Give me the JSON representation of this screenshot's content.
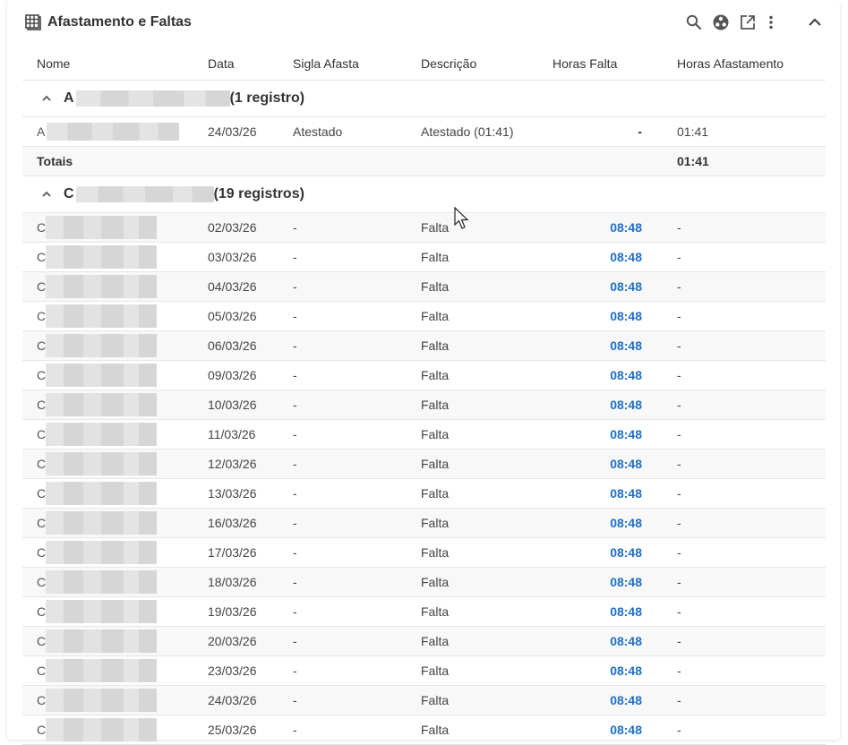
{
  "header": {
    "title": "Afastamento e Faltas",
    "icons": [
      "grid-table-icon",
      "search-icon",
      "share-icon",
      "open-external-icon",
      "more-vert-icon",
      "chevron-up-icon"
    ]
  },
  "columns": {
    "nome": "Nome",
    "data": "Data",
    "sigla": "Sigla Afasta",
    "descricao": "Descrição",
    "horas_falta": "Horas Falta",
    "horas_afastamento": "Horas Afastamento"
  },
  "group1": {
    "initial": "A",
    "count": "(1 registro)",
    "row": {
      "nome_initial": "A",
      "data": "24/03/26",
      "sigla": "Atestado",
      "descricao": "Atestado (01:41)",
      "horas_falta": "-",
      "horas_afastamento": "01:41"
    },
    "totals_label": "Totais",
    "totals_afastamento": "01:41"
  },
  "group2": {
    "initial": "C",
    "count": "(19 registros)",
    "rows": [
      {
        "nome_initial": "C",
        "data": "02/03/26",
        "sigla": "-",
        "descricao": "Falta",
        "horas_falta": "08:48",
        "horas_afastamento": "-"
      },
      {
        "nome_initial": "C",
        "data": "03/03/26",
        "sigla": "-",
        "descricao": "Falta",
        "horas_falta": "08:48",
        "horas_afastamento": "-"
      },
      {
        "nome_initial": "C",
        "data": "04/03/26",
        "sigla": "-",
        "descricao": "Falta",
        "horas_falta": "08:48",
        "horas_afastamento": "-"
      },
      {
        "nome_initial": "C",
        "data": "05/03/26",
        "sigla": "-",
        "descricao": "Falta",
        "horas_falta": "08:48",
        "horas_afastamento": "-"
      },
      {
        "nome_initial": "C",
        "data": "06/03/26",
        "sigla": "-",
        "descricao": "Falta",
        "horas_falta": "08:48",
        "horas_afastamento": "-"
      },
      {
        "nome_initial": "C",
        "data": "09/03/26",
        "sigla": "-",
        "descricao": "Falta",
        "horas_falta": "08:48",
        "horas_afastamento": "-"
      },
      {
        "nome_initial": "C",
        "data": "10/03/26",
        "sigla": "-",
        "descricao": "Falta",
        "horas_falta": "08:48",
        "horas_afastamento": "-"
      },
      {
        "nome_initial": "C",
        "data": "11/03/26",
        "sigla": "-",
        "descricao": "Falta",
        "horas_falta": "08:48",
        "horas_afastamento": "-"
      },
      {
        "nome_initial": "C",
        "data": "12/03/26",
        "sigla": "-",
        "descricao": "Falta",
        "horas_falta": "08:48",
        "horas_afastamento": "-"
      },
      {
        "nome_initial": "C",
        "data": "13/03/26",
        "sigla": "-",
        "descricao": "Falta",
        "horas_falta": "08:48",
        "horas_afastamento": "-"
      },
      {
        "nome_initial": "C",
        "data": "16/03/26",
        "sigla": "-",
        "descricao": "Falta",
        "horas_falta": "08:48",
        "horas_afastamento": "-"
      },
      {
        "nome_initial": "C",
        "data": "17/03/26",
        "sigla": "-",
        "descricao": "Falta",
        "horas_falta": "08:48",
        "horas_afastamento": "-"
      },
      {
        "nome_initial": "C",
        "data": "18/03/26",
        "sigla": "-",
        "descricao": "Falta",
        "horas_falta": "08:48",
        "horas_afastamento": "-"
      },
      {
        "nome_initial": "C",
        "data": "19/03/26",
        "sigla": "-",
        "descricao": "Falta",
        "horas_falta": "08:48",
        "horas_afastamento": "-"
      },
      {
        "nome_initial": "C",
        "data": "20/03/26",
        "sigla": "-",
        "descricao": "Falta",
        "horas_falta": "08:48",
        "horas_afastamento": "-"
      },
      {
        "nome_initial": "C",
        "data": "23/03/26",
        "sigla": "-",
        "descricao": "Falta",
        "horas_falta": "08:48",
        "horas_afastamento": "-"
      },
      {
        "nome_initial": "C",
        "data": "24/03/26",
        "sigla": "-",
        "descricao": "Falta",
        "horas_falta": "08:48",
        "horas_afastamento": "-"
      },
      {
        "nome_initial": "C",
        "data": "25/03/26",
        "sigla": "-",
        "descricao": "Falta",
        "horas_falta": "08:48",
        "horas_afastamento": "-"
      }
    ]
  },
  "colors": {
    "accent_blue": "#1e6fc8",
    "row_alt": "#f8f8f8",
    "divider": "#e6e6e6"
  }
}
